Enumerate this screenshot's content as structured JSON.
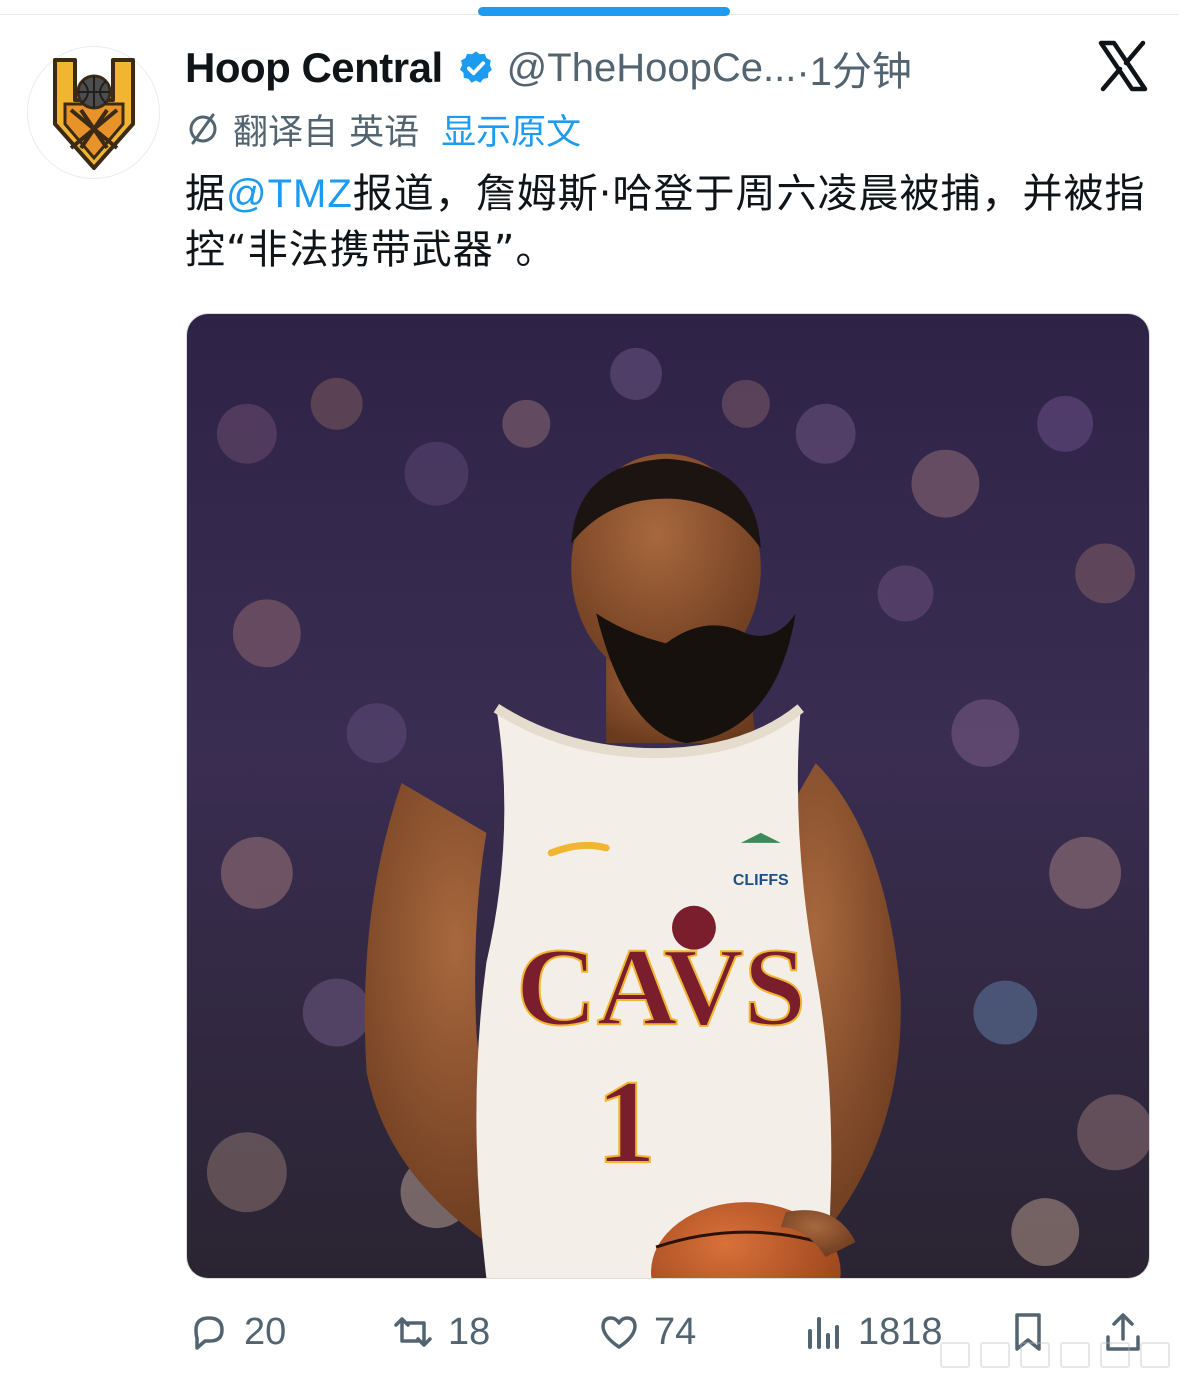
{
  "tweet": {
    "display_name": "Hoop Central",
    "handle": "@TheHoopCe...",
    "time": "·1分钟",
    "translated_from": "翻译自 英语",
    "show_original": "显示原文",
    "text_before_mention": "据",
    "mention": "@TMZ",
    "text_after_mention": "报道，詹姆斯·哈登于周六凌晨被捕，并被指控“非法携带武器”。"
  },
  "media": {
    "jersey_wordmark": "CAVS",
    "jersey_number": "1",
    "jersey_sponsor": "CLIFFS"
  },
  "actions": {
    "replies": "20",
    "retweets": "18",
    "likes": "74",
    "views": "1818"
  },
  "colors": {
    "accent": "#1d9bf0",
    "secondary_text": "#536471",
    "wine": "#7a1e2e",
    "gold": "#f2b531"
  },
  "icons": [
    "verified-badge-icon",
    "x-logo-icon",
    "translate-icon",
    "reply-icon",
    "retweet-icon",
    "like-icon",
    "views-icon",
    "bookmark-icon",
    "share-icon"
  ]
}
